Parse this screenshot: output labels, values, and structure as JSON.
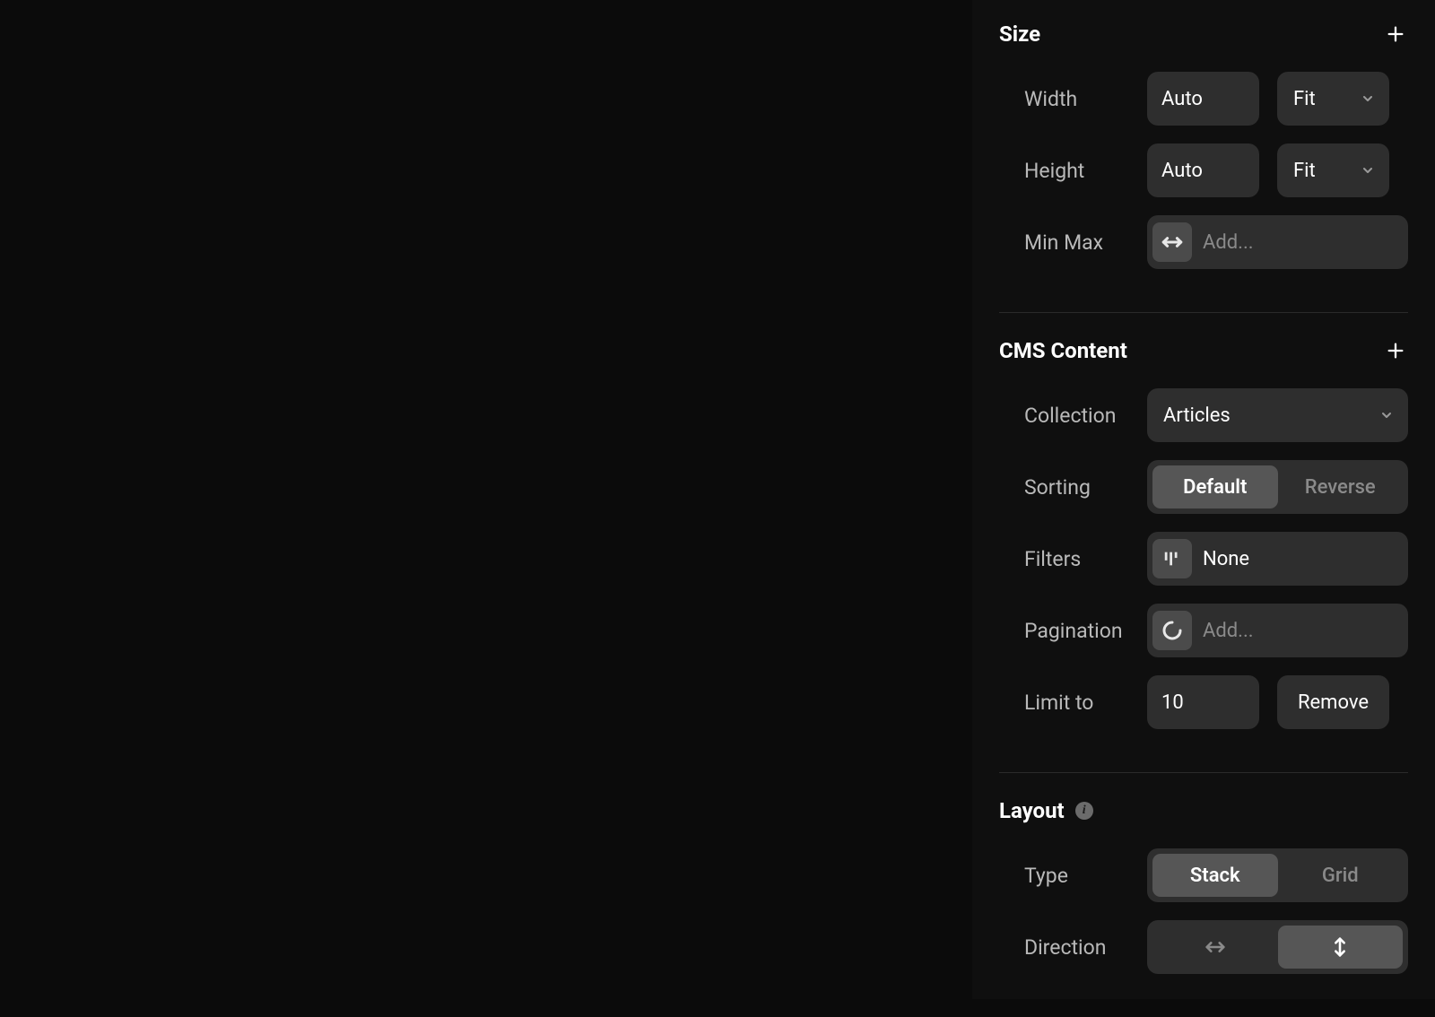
{
  "size": {
    "title": "Size",
    "width_label": "Width",
    "width_value": "Auto",
    "width_fit": "Fit",
    "height_label": "Height",
    "height_value": "Auto",
    "height_fit": "Fit",
    "minmax_label": "Min Max",
    "minmax_placeholder": "Add..."
  },
  "cms": {
    "title": "CMS Content",
    "collection_label": "Collection",
    "collection_value": "Articles",
    "sorting_label": "Sorting",
    "sorting_default": "Default",
    "sorting_reverse": "Reverse",
    "filters_label": "Filters",
    "filters_value": "None",
    "pagination_label": "Pagination",
    "pagination_placeholder": "Add...",
    "limit_label": "Limit to",
    "limit_value": "10",
    "remove_label": "Remove"
  },
  "layout": {
    "title": "Layout",
    "type_label": "Type",
    "type_stack": "Stack",
    "type_grid": "Grid",
    "direction_label": "Direction"
  }
}
